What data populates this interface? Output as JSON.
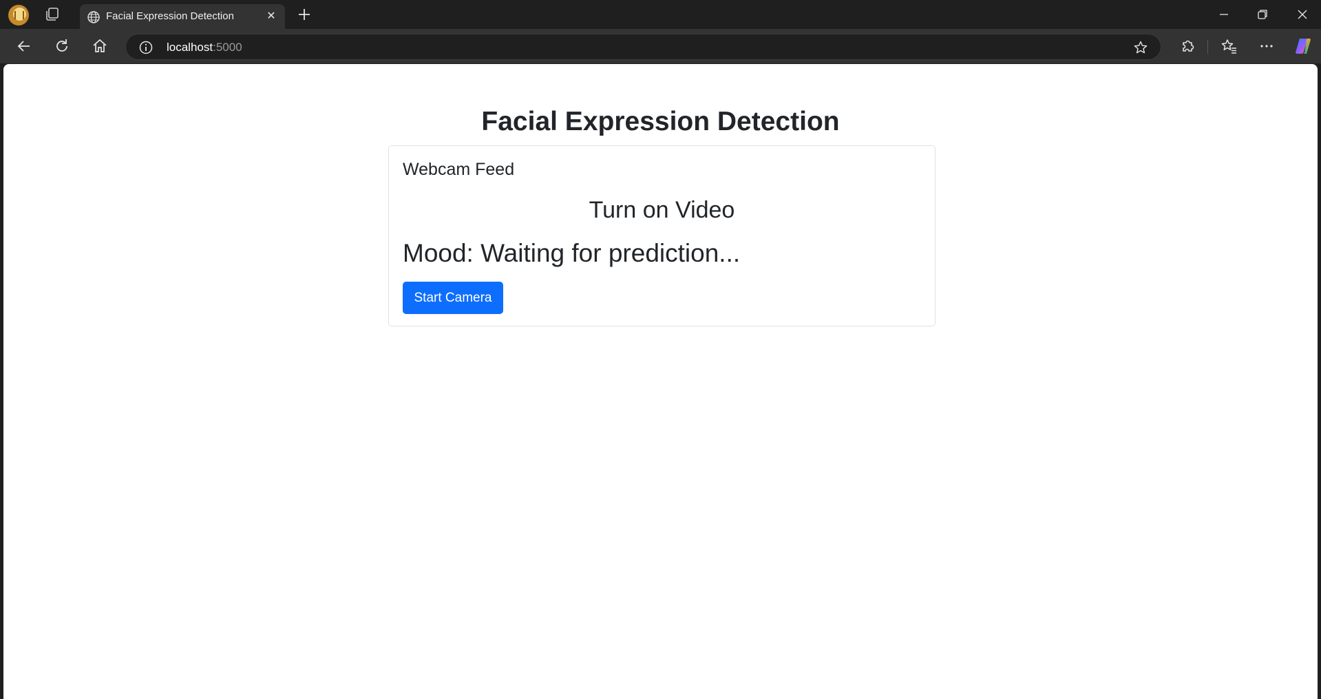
{
  "browser": {
    "tab": {
      "title": "Facial Expression Detection",
      "close_glyph": "✕"
    },
    "address": {
      "host": "localhost",
      "port": ":5000"
    },
    "icons": {
      "profile": "profile-avatar-icon",
      "tab_actions": "tab-actions-icon",
      "favicon": "globe-icon",
      "new_tab": "plus-icon",
      "minimize": "minimize-icon",
      "restore": "restore-icon",
      "close": "close-icon",
      "back": "back-arrow-icon",
      "refresh": "refresh-icon",
      "home": "home-icon",
      "info": "info-icon",
      "favorite": "star-icon",
      "extensions": "puzzle-icon",
      "favorites": "favorites-icon",
      "more": "more-icon",
      "copilot": "copilot-icon"
    }
  },
  "page": {
    "title": "Facial Expression Detection",
    "card": {
      "title": "Webcam Feed",
      "video_placeholder": "Turn on Video",
      "mood": "Mood: Waiting for prediction...",
      "start_button": "Start Camera"
    }
  },
  "colors": {
    "primary_button": "#0d6efd",
    "text": "#212529",
    "card_border": "#dee2e6",
    "browser_chrome": "#1f1f1f",
    "toolbar": "#333333"
  }
}
